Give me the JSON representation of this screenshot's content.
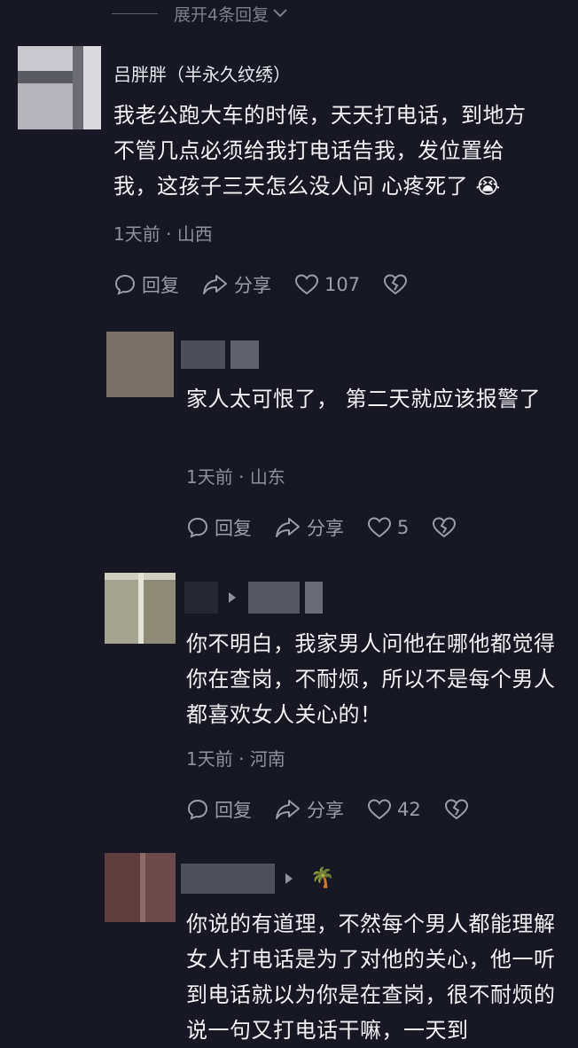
{
  "expand_replies": "展开4条回复",
  "comments": [
    {
      "name": "吕胖胖（半永久纹绣）",
      "text": "我老公跑大车的时候，天天打电话，到地方不管几点必须给我打电话告我，发位置给我，这孩子三天怎么没人问 心疼死了 😭",
      "time": "1天前",
      "location": "山西",
      "reply_label": "回复",
      "share_label": "分享",
      "likes": "107"
    },
    {
      "name": "",
      "text": "家人太可恨了， 第二天就应该报警了",
      "time": "1天前",
      "location": "山东",
      "reply_label": "回复",
      "share_label": "分享",
      "likes": "5"
    },
    {
      "name": "",
      "text": "你不明白，我家男人问他在哪他都觉得你在查岗，不耐烦，所以不是每个男人都喜欢女人关心的！",
      "time": "1天前",
      "location": "河南",
      "reply_label": "回复",
      "share_label": "分享",
      "likes": "42"
    },
    {
      "name": "",
      "badge": "🌴",
      "text": "你说的有道理，不然每个男人都能理解女人打电话是为了对他的关心，他一听到电话就以为你是在查岗，很不耐烦的说一句又打电话干嘛，一天到"
    }
  ],
  "colors": {
    "background": "#171824",
    "text": "#f3f3f6",
    "muted": "#8e909c"
  }
}
